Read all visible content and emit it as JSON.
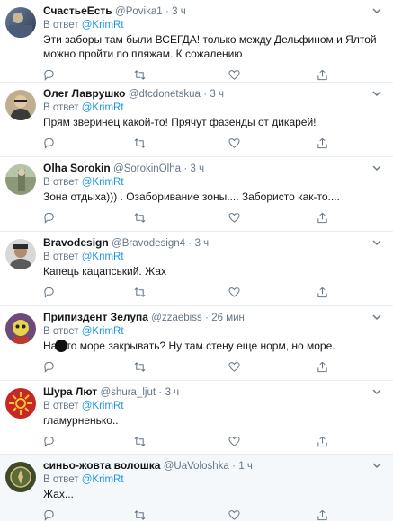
{
  "reply_prefix": "В ответ",
  "colors": {
    "link": "#1b95e0",
    "muted": "#657786",
    "text": "#14171a",
    "divider": "#e6ecf0"
  },
  "tweets": [
    {
      "name": "СчастьеЕсть",
      "handle": "@Povika1",
      "time": "3 ч",
      "mention": "@KrimRt",
      "text": "Эти заборы там были ВСЕГДА! только между Дельфином и Ялтой можно пройти по пляжам. К сожалению",
      "avatar": "avatar-gradient"
    },
    {
      "name": "Олег Лаврушко",
      "handle": "@dtcdonetskua",
      "time": "3 ч",
      "mention": "@KrimRt",
      "text": "Прям зверинец какой-то! Прячут фазенды от дикарей!",
      "avatar": "avatar-photo"
    },
    {
      "name": "Olha Sorokin",
      "handle": "@SorokinOlha",
      "time": "3 ч",
      "mention": "@KrimRt",
      "text": "Зона отдыха))) . Озаборивание зоны.... Забористо как-то....",
      "avatar": "avatar-photo"
    },
    {
      "name": "Bravodesign",
      "handle": "@Bravodesign4",
      "time": "3 ч",
      "mention": "@KrimRt",
      "text": "Капець кацапський. Жах",
      "avatar": "avatar-photo"
    },
    {
      "name": "Припиздент Зелупа",
      "handle": "@zzaebiss",
      "time": "26 мин",
      "mention": "@KrimRt",
      "text_before": "На",
      "text_after": "то море закрывать? Ну там стену еще норм, но море.",
      "avatar": "avatar-character"
    },
    {
      "name": "Шура Лют",
      "handle": "@shura_ljut",
      "time": "3 ч",
      "mention": "@KrimRt",
      "text": "гламурненько..",
      "avatar": "avatar-sun-symbol"
    },
    {
      "name": "синьо-жовта волошка",
      "handle": "@UaVoloshka",
      "time": "1 ч",
      "mention": "@KrimRt",
      "text": "Жах...",
      "avatar": "avatar-emblem"
    }
  ],
  "icons": {
    "reply": "reply-icon",
    "retweet": "retweet-icon",
    "like": "like-icon",
    "share": "share-icon",
    "more": "chevron-down-icon"
  }
}
